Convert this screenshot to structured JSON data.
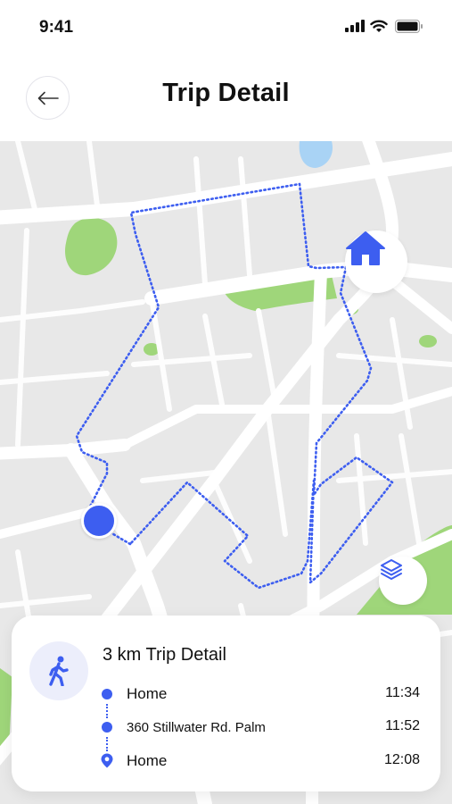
{
  "status_bar": {
    "time": "9:41",
    "icons": [
      "signal-icon",
      "wifi-icon",
      "battery-icon"
    ]
  },
  "header": {
    "title": "Trip Detail",
    "back_icon": "arrow-left-icon"
  },
  "map": {
    "route_color": "#3d5ef0",
    "road_color": "#ffffff",
    "land_color": "#e8e8e8",
    "park_color": "#9fd67a",
    "water_color": "#a9d3f5",
    "home_icon": "home-icon",
    "layers_icon": "layers-icon"
  },
  "trip": {
    "title": "3 km Trip Detail",
    "icon": "walking-person-icon",
    "stops": [
      {
        "name": "Home",
        "time": "11:34",
        "marker": "dot"
      },
      {
        "name": "360 Stillwater Rd. Palm",
        "time": "11:52",
        "marker": "dot"
      },
      {
        "name": "Home",
        "time": "12:08",
        "marker": "pin"
      }
    ]
  },
  "colors": {
    "accent": "#3d5ef0",
    "badge_bg": "#eceefb"
  }
}
